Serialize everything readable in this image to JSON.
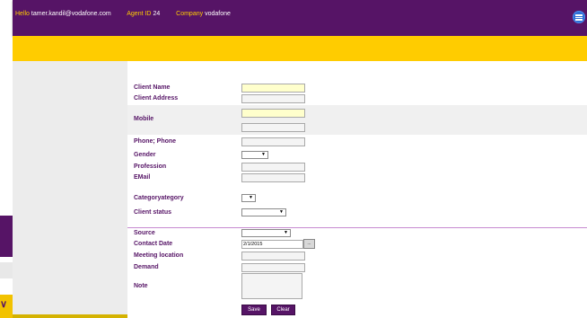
{
  "header": {
    "hello_label": "Hello",
    "email": "tamer.kandil@vodafone.com",
    "agent_label": "Agent ID",
    "agent_id": "24",
    "company_label": "Company",
    "company": "vodafone",
    "menu_icon": "hamburger-menu-icon"
  },
  "form": {
    "client_name": {
      "label": "Client Name",
      "value": ""
    },
    "client_address": {
      "label": "Client Address",
      "value": ""
    },
    "mobile": {
      "label": "Mobile",
      "value_1": "",
      "value_2": ""
    },
    "phone": {
      "label": "Phone; Phone",
      "value": ""
    },
    "gender": {
      "label": "Gender",
      "selected": ""
    },
    "profession": {
      "label": "Profession",
      "value": ""
    },
    "email": {
      "label": "EMail",
      "value": ""
    },
    "category": {
      "label": "Categoryategory",
      "selected": ""
    },
    "client_status": {
      "label": "Client status",
      "selected": ""
    },
    "source": {
      "label": "Source",
      "selected": ""
    },
    "contact_date": {
      "label": "Contact Date",
      "value": "2/1/2015",
      "picker_label": "..."
    },
    "meeting_location": {
      "label": "Meeting location",
      "value": ""
    },
    "demand": {
      "label": "Demand",
      "value": ""
    },
    "note": {
      "label": "Note",
      "value": ""
    }
  },
  "actions": {
    "save_label": "Save",
    "clear_label": "Clear"
  },
  "colors": {
    "brand_purple": "#561466",
    "brand_yellow": "#ffcc00",
    "label_purple": "#561466",
    "divider": "#c78ad0"
  }
}
